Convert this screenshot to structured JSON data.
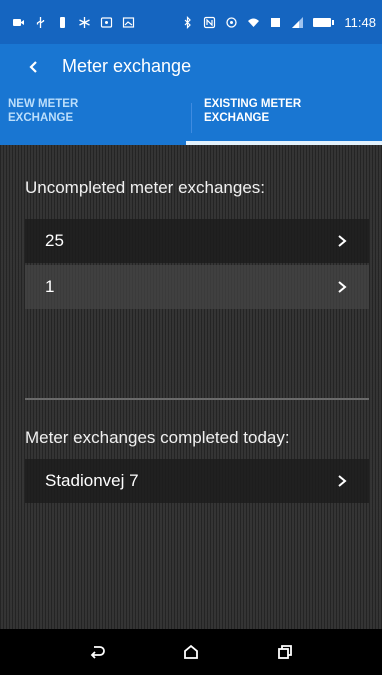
{
  "status_bar": {
    "time": "11:48",
    "left_icons": [
      "video-icon",
      "usb-icon",
      "phone-alert-icon",
      "accessibility-icon",
      "cast-icon",
      "image-icon"
    ],
    "right_icons": [
      "bluetooth-icon",
      "nfc-icon",
      "sync-icon",
      "wifi-icon",
      "data-icon",
      "signal-icon",
      "battery-icon"
    ]
  },
  "app_bar": {
    "title": "Meter exchange",
    "back_icon": "chevron-left-icon"
  },
  "tabs": [
    {
      "label_line1": "NEW METER",
      "label_line2": "EXCHANGE",
      "selected": false
    },
    {
      "label_line1": "EXISTING METER",
      "label_line2": "EXCHANGE",
      "selected": true
    }
  ],
  "uncompleted": {
    "title": "Uncompleted meter exchanges:",
    "items": [
      {
        "label": "25"
      },
      {
        "label": "1"
      }
    ]
  },
  "completed_today": {
    "title": "Meter exchanges completed today:",
    "items": [
      {
        "label": "Stadionvej 7"
      }
    ]
  },
  "nav_bar": {
    "buttons": [
      "back-icon",
      "home-icon",
      "recents-icon"
    ]
  },
  "colors": {
    "status_bar": "#1565c0",
    "app_bar": "#1976d2",
    "content_bg": "#2e2e2e",
    "nav_bar": "#000000"
  }
}
